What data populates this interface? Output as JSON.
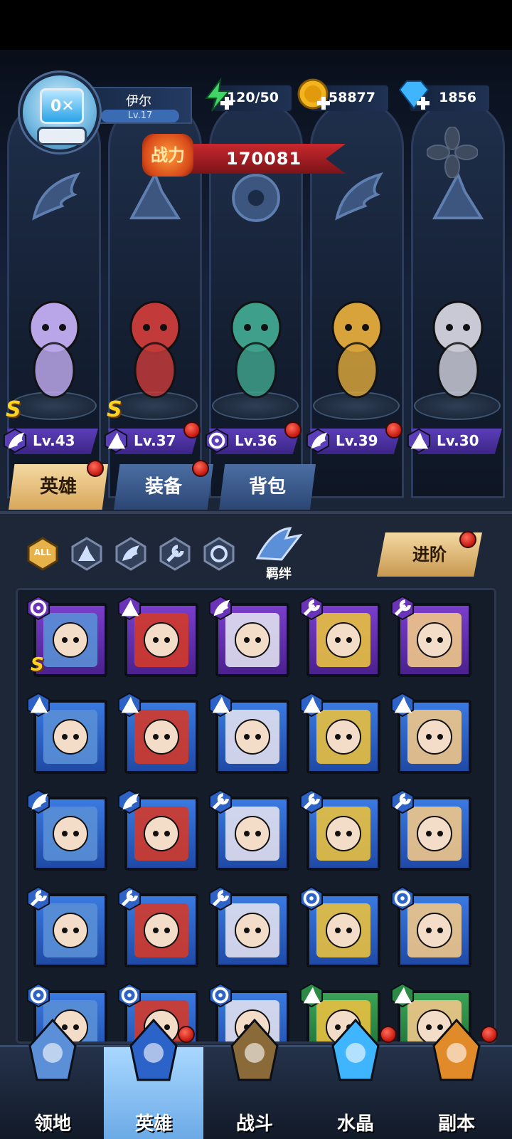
{
  "player": {
    "name": "伊尔",
    "level": "Lv.17",
    "avatar_icon": "robot-fish-tank-icon"
  },
  "resources": [
    {
      "name": "energy",
      "icon": "lightning-plus-icon",
      "value": "120/50"
    },
    {
      "name": "gold",
      "icon": "gold-coin-plus-icon",
      "value": "58877"
    },
    {
      "name": "diamond",
      "icon": "diamond-plus-icon",
      "value": "1856"
    }
  ],
  "power": {
    "label": "战力",
    "value": "170081"
  },
  "lineup": [
    {
      "level": "Lv.43",
      "class_icon": "wing-icon",
      "rank": "S",
      "has_badge": false
    },
    {
      "level": "Lv.37",
      "class_icon": "hat-icon",
      "rank": "S",
      "has_badge": true
    },
    {
      "level": "Lv.36",
      "class_icon": "fang-icon",
      "rank": "",
      "has_badge": true
    },
    {
      "level": "Lv.39",
      "class_icon": "wing-icon",
      "rank": "",
      "has_badge": true
    },
    {
      "level": "Lv.30",
      "class_icon": "hat-icon",
      "rank": "",
      "has_badge": false
    }
  ],
  "tabs": [
    {
      "label": "英雄",
      "active": true
    },
    {
      "label": "装备",
      "active": false
    },
    {
      "label": "背包",
      "active": false
    }
  ],
  "filters": [
    {
      "label": "ALL",
      "icon": "all-icon"
    },
    {
      "icon": "hat-icon"
    },
    {
      "icon": "wing-icon"
    },
    {
      "icon": "wrench-icon"
    },
    {
      "icon": "fang-icon"
    }
  ],
  "bond": {
    "label": "羁绊",
    "icon": "bond-icon"
  },
  "advance": {
    "label": "进阶"
  },
  "colors": {
    "purple": "#6a34b8",
    "blue": "#2d62c7",
    "green": "#2a8a46",
    "gold": "#e4b66a",
    "red": "#c4180f"
  },
  "roster": [
    {
      "frame": "purple",
      "class_icon": "fang-icon",
      "rank": "S"
    },
    {
      "frame": "purple",
      "class_icon": "hat-icon",
      "rank": ""
    },
    {
      "frame": "purple",
      "class_icon": "wing-icon",
      "rank": ""
    },
    {
      "frame": "purple",
      "class_icon": "wrench-icon",
      "rank": ""
    },
    {
      "frame": "purple",
      "class_icon": "wrench-icon",
      "rank": ""
    },
    {
      "frame": "blue",
      "class_icon": "hat-icon",
      "rank": ""
    },
    {
      "frame": "blue",
      "class_icon": "hat-icon",
      "rank": ""
    },
    {
      "frame": "blue",
      "class_icon": "hat-icon",
      "rank": ""
    },
    {
      "frame": "blue",
      "class_icon": "hat-icon",
      "rank": ""
    },
    {
      "frame": "blue",
      "class_icon": "hat-icon",
      "rank": ""
    },
    {
      "frame": "blue",
      "class_icon": "wing-icon",
      "rank": ""
    },
    {
      "frame": "blue",
      "class_icon": "wing-icon",
      "rank": ""
    },
    {
      "frame": "blue",
      "class_icon": "wrench-icon",
      "rank": ""
    },
    {
      "frame": "blue",
      "class_icon": "wrench-icon",
      "rank": ""
    },
    {
      "frame": "blue",
      "class_icon": "wrench-icon",
      "rank": ""
    },
    {
      "frame": "blue",
      "class_icon": "wrench-icon",
      "rank": ""
    },
    {
      "frame": "blue",
      "class_icon": "wrench-icon",
      "rank": ""
    },
    {
      "frame": "blue",
      "class_icon": "wrench-icon",
      "rank": ""
    },
    {
      "frame": "blue",
      "class_icon": "fang-icon",
      "rank": ""
    },
    {
      "frame": "blue",
      "class_icon": "fang-icon",
      "rank": ""
    },
    {
      "frame": "blue",
      "class_icon": "fang-icon",
      "rank": ""
    },
    {
      "frame": "blue",
      "class_icon": "fang-icon",
      "rank": ""
    },
    {
      "frame": "blue",
      "class_icon": "fang-icon",
      "rank": ""
    },
    {
      "frame": "green",
      "class_icon": "hat-icon",
      "rank": ""
    },
    {
      "frame": "green",
      "class_icon": "hat-icon",
      "rank": ""
    }
  ],
  "bottom_nav": [
    {
      "label": "领地",
      "icon": "castle-icon",
      "active": false,
      "has_badge": false
    },
    {
      "label": "英雄",
      "icon": "wizard-hat-icon",
      "active": true,
      "has_badge": true
    },
    {
      "label": "战斗",
      "icon": "sword-altar-icon",
      "active": false,
      "has_badge": false
    },
    {
      "label": "水晶",
      "icon": "crystal-icon",
      "active": false,
      "has_badge": true
    },
    {
      "label": "副本",
      "icon": "portal-icon",
      "active": false,
      "has_badge": true
    }
  ]
}
